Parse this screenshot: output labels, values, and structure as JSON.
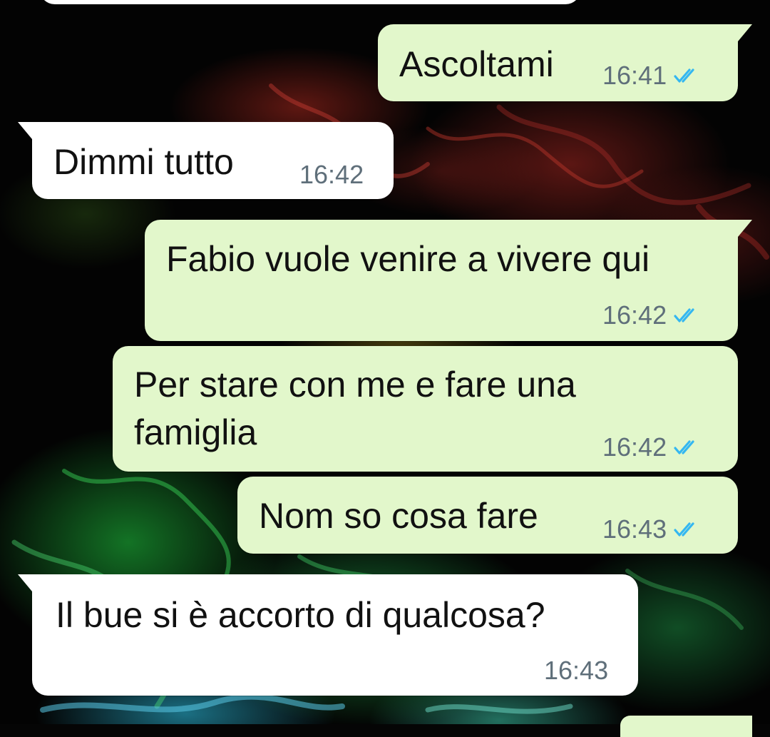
{
  "chat": {
    "messages": [
      {
        "direction": "outgoing",
        "text": "Ascoltami",
        "time": "16:41",
        "status": "read-double-check"
      },
      {
        "direction": "incoming",
        "text": "Dimmi tutto",
        "time": "16:42"
      },
      {
        "direction": "outgoing",
        "text": "Fabio vuole venire a vivere qui",
        "time": "16:42",
        "status": "read-double-check"
      },
      {
        "direction": "outgoing",
        "text_line1": "Per stare con me e fare una",
        "text_line2": "famiglia",
        "time": "16:42",
        "status": "read-double-check"
      },
      {
        "direction": "outgoing",
        "text": "Nom so cosa fare",
        "time": "16:43",
        "status": "read-double-check"
      },
      {
        "direction": "incoming",
        "text": "Il bue si è accorto di qualcosa?",
        "time": "16:43"
      }
    ]
  },
  "icons": {
    "read_receipt": "double-check-icon"
  },
  "colors": {
    "outgoing_bubble": "#e2f7cb",
    "incoming_bubble": "#ffffff",
    "timestamp": "#5f6f7a",
    "read_ticks": "#34b7f1",
    "wallpaper_base": "#030303"
  }
}
